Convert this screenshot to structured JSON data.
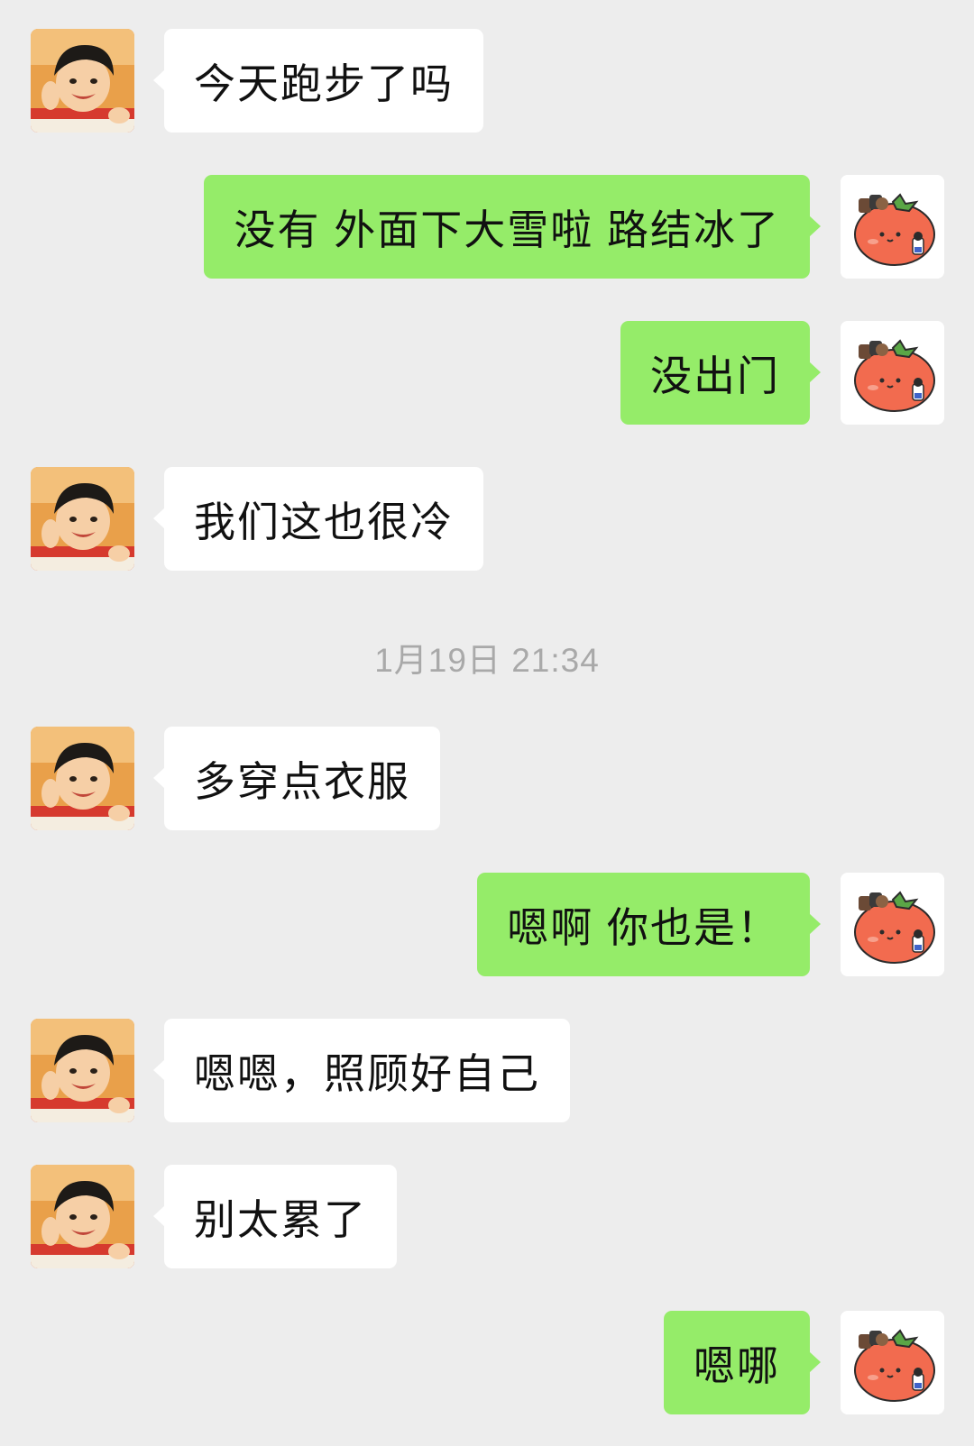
{
  "chat": {
    "messages": [
      {
        "side": "left",
        "text": "今天跑步了吗",
        "avatar": "child-photo-avatar"
      },
      {
        "side": "right",
        "text": "没有 外面下大雪啦 路结冰了",
        "avatar": "tomato-cartoon-avatar"
      },
      {
        "side": "right",
        "text": "没出门",
        "avatar": "tomato-cartoon-avatar"
      },
      {
        "side": "left",
        "text": "我们这也很冷",
        "avatar": "child-photo-avatar"
      },
      {
        "side": "left",
        "text": "多穿点衣服",
        "avatar": "child-photo-avatar"
      },
      {
        "side": "right",
        "text": "嗯啊 你也是！",
        "avatar": "tomato-cartoon-avatar"
      },
      {
        "side": "left",
        "text": "嗯嗯，照顾好自己",
        "avatar": "child-photo-avatar"
      },
      {
        "side": "left",
        "text": "别太累了",
        "avatar": "child-photo-avatar"
      },
      {
        "side": "right",
        "text": "嗯哪",
        "avatar": "tomato-cartoon-avatar"
      }
    ],
    "timestamp": "1月19日 21:34"
  },
  "colors": {
    "background": "#ededed",
    "incoming_bubble": "#ffffff",
    "outgoing_bubble": "#95ec69",
    "timestamp_text": "#a9a9a9"
  }
}
